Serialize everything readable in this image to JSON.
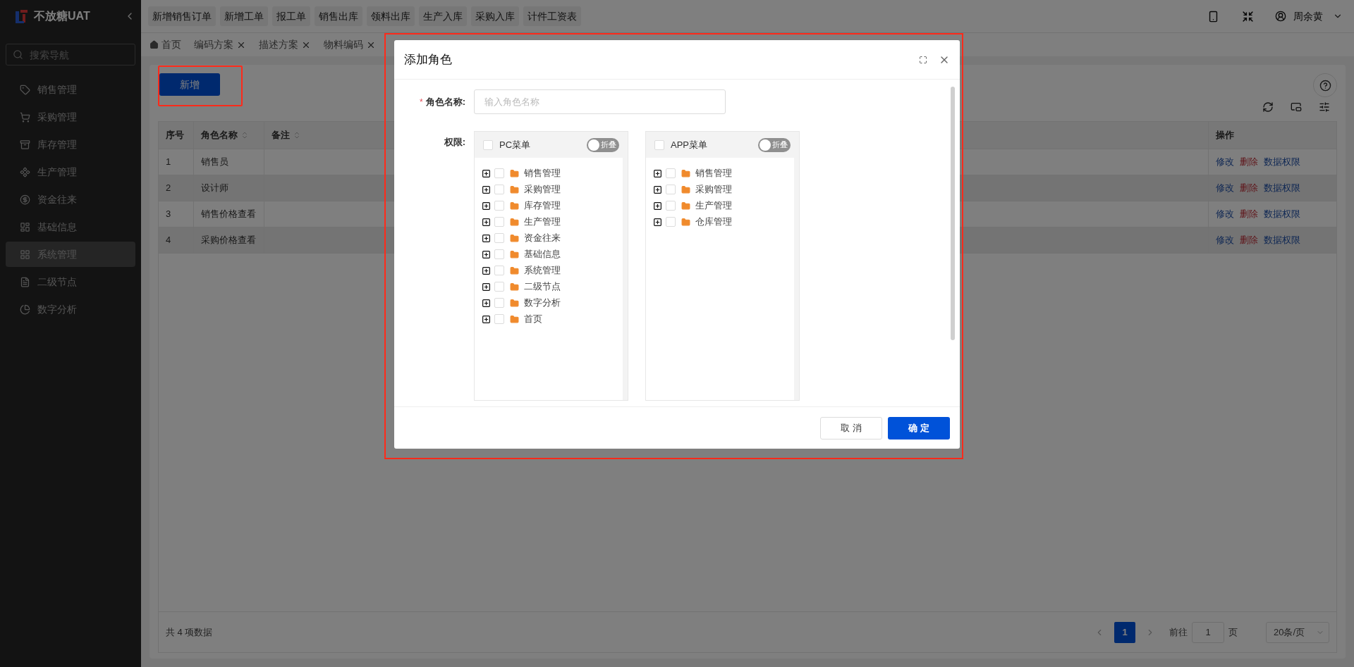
{
  "brand": {
    "name": "不放糖UAT"
  },
  "sidebar": {
    "search_placeholder": "搜索导航",
    "items": [
      {
        "label": "销售管理",
        "selected": false
      },
      {
        "label": "采购管理",
        "selected": false
      },
      {
        "label": "库存管理",
        "selected": false
      },
      {
        "label": "生产管理",
        "selected": false
      },
      {
        "label": "资金往来",
        "selected": false
      },
      {
        "label": "基础信息",
        "selected": false
      },
      {
        "label": "系统管理",
        "selected": true
      },
      {
        "label": "二级节点",
        "selected": false
      },
      {
        "label": "数字分析",
        "selected": false
      }
    ]
  },
  "quick_actions": [
    "新增销售订单",
    "新增工单",
    "报工单",
    "销售出库",
    "领料出库",
    "生产入库",
    "采购入库",
    "计件工资表"
  ],
  "header": {
    "user": "周余黄"
  },
  "tabs": [
    {
      "label": "首页",
      "closable": false,
      "selected": false
    },
    {
      "label": "编码方案",
      "closable": true,
      "selected": false
    },
    {
      "label": "描述方案",
      "closable": true,
      "selected": false
    },
    {
      "label": "物料编码",
      "closable": true,
      "selected": false
    }
  ],
  "toolbar": {
    "add_button": "新增"
  },
  "table": {
    "columns": [
      {
        "label": "序号",
        "sortable": false
      },
      {
        "label": "角色名称",
        "sortable": true
      },
      {
        "label": "备注",
        "sortable": true
      },
      {
        "label": "操作",
        "sortable": false
      }
    ],
    "rows": [
      {
        "index": "1",
        "name": "销售员",
        "actions": [
          {
            "label": "修改",
            "kind": "link"
          },
          {
            "label": "删除",
            "kind": "danger"
          },
          {
            "label": "数据权限",
            "kind": "link"
          }
        ]
      },
      {
        "index": "2",
        "name": "设计师",
        "actions": [
          {
            "label": "修改",
            "kind": "link"
          },
          {
            "label": "删除",
            "kind": "danger"
          },
          {
            "label": "数据权限",
            "kind": "link"
          }
        ]
      },
      {
        "index": "3",
        "name": "销售价格查看",
        "actions": [
          {
            "label": "修改",
            "kind": "link"
          },
          {
            "label": "删除",
            "kind": "danger"
          },
          {
            "label": "数据权限",
            "kind": "link"
          }
        ]
      },
      {
        "index": "4",
        "name": "采购价格查看",
        "actions": [
          {
            "label": "修改",
            "kind": "link"
          },
          {
            "label": "删除",
            "kind": "danger"
          },
          {
            "label": "数据权限",
            "kind": "link"
          }
        ]
      }
    ]
  },
  "pagination": {
    "total": "共 4 项数据",
    "pages": [
      {
        "label": "1",
        "selected": true
      }
    ],
    "goto_prefix": "前往",
    "goto_value": "1",
    "goto_suffix": "页",
    "page_size": "20条/页"
  },
  "dialog": {
    "title": "添加角色",
    "name_field": {
      "label": "角色名称:",
      "required_mark": "*",
      "placeholder": "输入角色名称"
    },
    "permissions_label": "权限:",
    "panels": [
      {
        "title": "PC菜单",
        "checked": false,
        "toggle": {
          "label": "折叠",
          "on": false
        },
        "items": [
          {
            "label": "销售管理",
            "checked": false,
            "expanded": false
          },
          {
            "label": "采购管理",
            "checked": false,
            "expanded": false
          },
          {
            "label": "库存管理",
            "checked": false,
            "expanded": false
          },
          {
            "label": "生产管理",
            "checked": false,
            "expanded": false
          },
          {
            "label": "资金往来",
            "checked": false,
            "expanded": false
          },
          {
            "label": "基础信息",
            "checked": false,
            "expanded": false
          },
          {
            "label": "系统管理",
            "checked": false,
            "expanded": false
          },
          {
            "label": "二级节点",
            "checked": false,
            "expanded": false
          },
          {
            "label": "数字分析",
            "checked": false,
            "expanded": false
          },
          {
            "label": "首页",
            "checked": false,
            "expanded": false
          }
        ]
      },
      {
        "title": "APP菜单",
        "checked": false,
        "toggle": {
          "label": "折叠",
          "on": false
        },
        "items": [
          {
            "label": "销售管理",
            "checked": false,
            "expanded": false
          },
          {
            "label": "采购管理",
            "checked": false,
            "expanded": false
          },
          {
            "label": "生产管理",
            "checked": false,
            "expanded": false
          },
          {
            "label": "仓库管理",
            "checked": false,
            "expanded": false
          }
        ]
      }
    ],
    "buttons": [
      {
        "label": "取 消",
        "kind": "secondary"
      },
      {
        "label": "确 定",
        "kind": "primary"
      }
    ]
  }
}
